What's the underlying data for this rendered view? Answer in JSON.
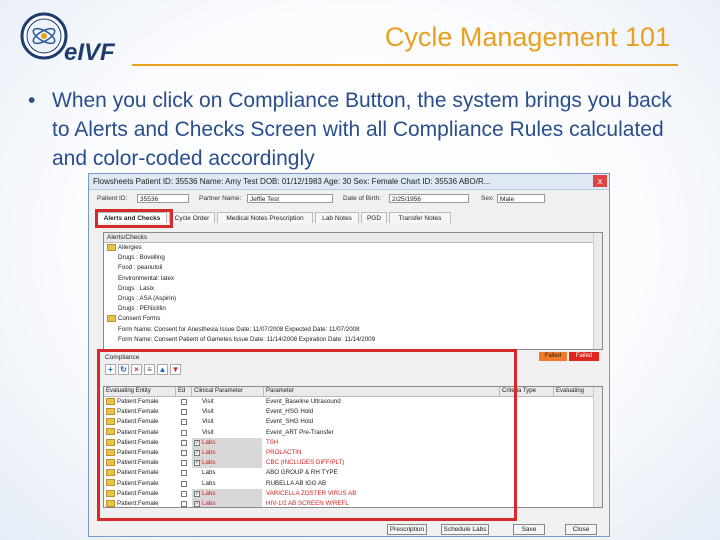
{
  "slide": {
    "title": "Cycle Management 101",
    "brand": "eIVF",
    "bullet": "When you click on Compliance Button, the system brings you back to Alerts and Checks Screen with all Compliance Rules calculated and color-coded accordingly"
  },
  "window": {
    "titlebar_text": "Flowsheets   Patient ID: 35536   Name: Amy Test   DOB: 01/12/1983   Age: 30   Sex: Female   Chart ID: 35536  ABO/R...",
    "close": "x",
    "fields": {
      "patient_id_label": "Patient ID:",
      "patient_id": "35536",
      "partner_label": "Partner Name:",
      "partner": "Jeffie Test",
      "dob_label": "Date of Birth:",
      "dob": "2/25/1956",
      "sex_label": "Sex:",
      "sex": "Male"
    },
    "tabs": [
      "Alerts and Checks",
      "Cycle Order",
      "Medical Notes Prescription",
      "Lab Notes",
      "PGD",
      "Transfer Notes"
    ],
    "alerts": {
      "header": "Alerts/Checks",
      "items": [
        {
          "text": "Allergies",
          "folder": true
        },
        {
          "text": "Drugs : Bovelling",
          "folder": false
        },
        {
          "text": "Food : peanutoil",
          "folder": false
        },
        {
          "text": "Environmental: latex",
          "folder": false
        },
        {
          "text": "Drugs : Lasix",
          "folder": false
        },
        {
          "text": "Drugs : ASA (Aspirin)",
          "folder": false
        },
        {
          "text": "Drugs : PENicillin",
          "folder": false
        },
        {
          "text": "Consent Forms",
          "folder": true
        },
        {
          "text": "Form Name: Consent for Anesthesia  Issue Date: 11/07/2008  Expected Date: 11/07/2008",
          "folder": false
        },
        {
          "text": "Form Name: Consent Patient of Gametes  Issue Date: 11/14/2008  Expiration Date: 11/14/2009",
          "folder": false
        }
      ]
    },
    "compliance_label": "Compliance",
    "legend": {
      "orange": "Failed",
      "red": "Failed"
    },
    "grid": {
      "headers": [
        "Evaluating Entity",
        "Ed",
        "Clinical Parameter",
        "Parameter",
        "Criteria Type",
        "Evaluating"
      ],
      "rows": [
        {
          "entity": "Patient:Female",
          "checked": false,
          "clinical": "Visit",
          "param": "Event_Baseline Ultrasound",
          "lab": false,
          "red": false
        },
        {
          "entity": "Patient:Female",
          "checked": false,
          "clinical": "Visit",
          "param": "Event_HSG Hold",
          "lab": false,
          "red": false
        },
        {
          "entity": "Patient:Female",
          "checked": false,
          "clinical": "Visit",
          "param": "Event_SHG Hold",
          "lab": false,
          "red": false
        },
        {
          "entity": "Patient:Female",
          "checked": false,
          "clinical": "Visit",
          "param": "Event_ART Pre-Transfer",
          "lab": false,
          "red": false
        },
        {
          "entity": "Patient:Female",
          "checked": true,
          "clinical": "Labs",
          "param": "TSH",
          "lab": true,
          "red": true
        },
        {
          "entity": "Patient:Female",
          "checked": true,
          "clinical": "Labs",
          "param": "PROLACTIN",
          "lab": true,
          "red": true
        },
        {
          "entity": "Patient:Female",
          "checked": true,
          "clinical": "Labs",
          "param": "CBC (INCLUDES DIFF/PLT)",
          "lab": true,
          "red": true
        },
        {
          "entity": "Patient:Female",
          "checked": false,
          "clinical": "Labs",
          "param": "ABO GROUP & RH TYPE",
          "lab": false,
          "red": false
        },
        {
          "entity": "Patient:Female",
          "checked": false,
          "clinical": "Labs",
          "param": "RUBELLA AB IGG AB",
          "lab": false,
          "red": false
        },
        {
          "entity": "Patient:Female",
          "checked": true,
          "clinical": "Labs",
          "param": "VARICELLA ZOSTER VIRUS AB",
          "lab": true,
          "red": true
        },
        {
          "entity": "Patient:Female",
          "checked": true,
          "clinical": "Labs",
          "param": "HIV-1/2 AB SCREEN W/REFL",
          "lab": true,
          "red": true
        }
      ]
    },
    "buttons": [
      "Prescription",
      "Schedule Labs",
      "Save",
      "Close"
    ]
  }
}
